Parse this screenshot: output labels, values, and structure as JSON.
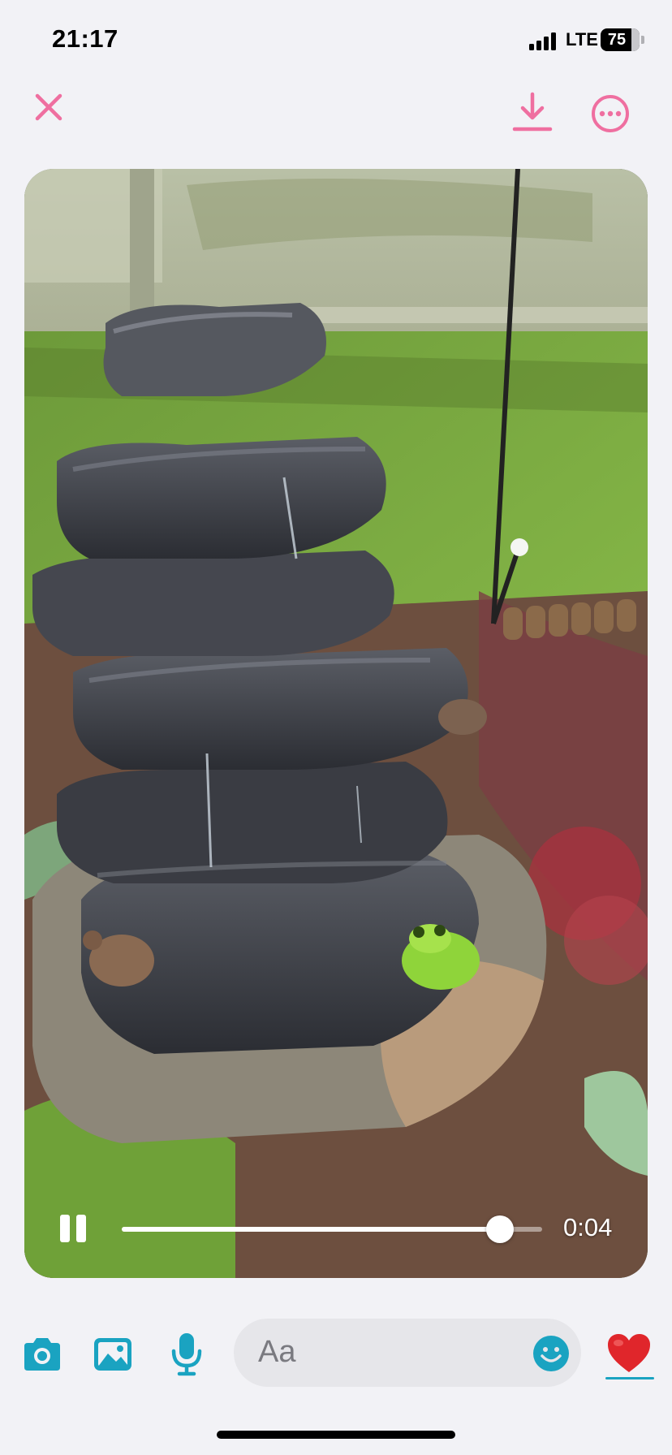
{
  "status_bar": {
    "time": "21:17",
    "network": "LTE",
    "battery_level": "75"
  },
  "toolbar": {
    "close_icon": "close-icon",
    "download_icon": "download-icon",
    "more_icon": "more-options-icon"
  },
  "video": {
    "state": "playing",
    "control_icon": "pause-icon",
    "elapsed": "0:04",
    "progress_fraction": 0.9
  },
  "composer": {
    "placeholder": "Aa",
    "icons": [
      "camera-icon",
      "image-icon",
      "microphone-icon",
      "emoji-icon",
      "heart-icon"
    ]
  },
  "colors": {
    "accent_pink": "#ef6fa0",
    "accent_teal": "#1aa3c1",
    "heart_red": "#e0262b"
  }
}
